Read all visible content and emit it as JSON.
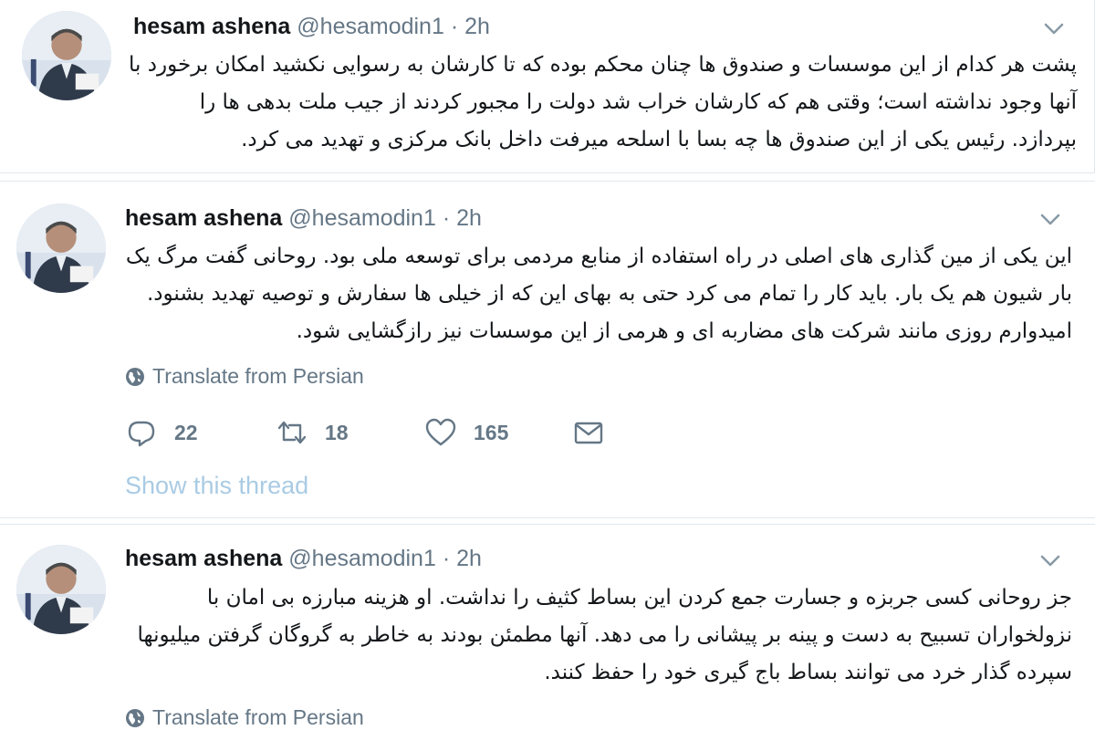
{
  "colors": {
    "text": "#14171a",
    "muted": "#657786",
    "link_light": "#a9cbe4",
    "divider": "#e1e8ed"
  },
  "tweets": [
    {
      "name": "hesam ashena",
      "handle": "@hesamodin1",
      "dot": "·",
      "time": "2h",
      "lines": [
        "پشت هر کدام از این موسسات و صندوق ها چنان محکم بوده که تا کارشان به رسوایی نکشید امکان برخورد با",
        "آنها وجود نداشته است؛ وقتی هم که کارشان خراب شد دولت را مجبور کردند از جیب ملت بدهی ها را",
        "بپردازد. رئیس یکی از این صندوق ها چه بسا با اسلحه میرفت داخل بانک مرکزی و تهدید می کرد."
      ]
    },
    {
      "name": "hesam ashena",
      "handle": "@hesamodin1",
      "dot": "·",
      "time": "2h",
      "lines": [
        "این یکی از مین گذاری های اصلی در راه استفاده از منابع مردمی برای توسعه ملی بود. روحانی گفت مرگ یک",
        "بار شیون هم یک بار. باید کار را تمام می کرد حتی به بهای این که از خیلی ها سفارش و توصیه تهدید بشنود.",
        "امیدوارم روزی مانند شرکت های مضاربه ای و هرمی از این موسسات نیز رازگشایی شود."
      ],
      "translate": "Translate from Persian",
      "actions": {
        "reply_count": "22",
        "retweet_count": "18",
        "like_count": "165"
      },
      "show_thread": "Show this thread"
    },
    {
      "name": "hesam ashena",
      "handle": "@hesamodin1",
      "dot": "·",
      "time": "2h",
      "lines": [
        "جز روحانی کسی جربزه و جسارت جمع کردن این بساط کثیف را نداشت. او هزینه مبارزه بی امان با",
        "نزولخواران تسبیح به دست و پینه بر پیشانی را می دهد. آنها مطمئن بودند به خاطر به گروگان گرفتن میلیونها",
        "سپرده گذار خرد می توانند بساط باج گیری خود را حفظ کنند."
      ],
      "translate": "Translate from Persian"
    }
  ],
  "icons": {
    "chevron": "chevron-down-icon",
    "globe": "globe-icon",
    "reply": "reply-icon",
    "retweet": "retweet-icon",
    "like": "heart-icon",
    "dm": "envelope-icon"
  }
}
